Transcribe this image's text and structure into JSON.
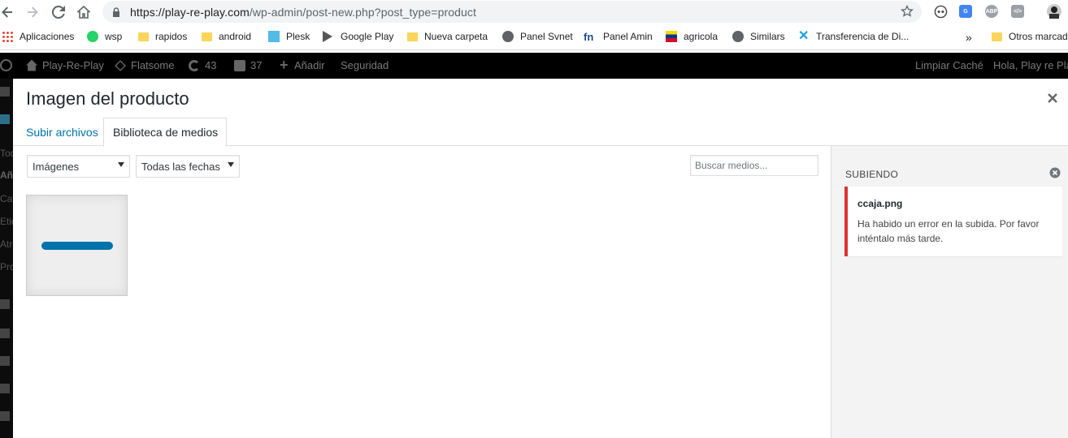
{
  "browser": {
    "url_host": "https://play-re-play.com",
    "url_path": "/wp-admin/post-new.php?post_type=product",
    "bookmarks": [
      {
        "label": "Aplicaciones",
        "icon": "apps-grid-icon"
      },
      {
        "label": "wsp",
        "icon": "whatsapp-icon"
      },
      {
        "label": "rapidos",
        "icon": "folder-icon"
      },
      {
        "label": "android",
        "icon": "folder-icon"
      },
      {
        "label": "Plesk",
        "icon": "plesk-icon"
      },
      {
        "label": "Google Play",
        "icon": "google-play-icon"
      },
      {
        "label": "Nueva carpeta",
        "icon": "folder-icon"
      },
      {
        "label": "Panel Svnet",
        "icon": "globe-icon"
      },
      {
        "label": "Panel Amin",
        "icon": "fn-icon"
      },
      {
        "label": "agricola",
        "icon": "flag-icon"
      },
      {
        "label": "Similars",
        "icon": "globe-icon"
      },
      {
        "label": "Transferencia de Di...",
        "icon": "x-logo-icon"
      }
    ],
    "more_bookmarks": "»",
    "other_bookmarks": "Otros marcad"
  },
  "adminbar": {
    "site_name": "Play-Re-Play",
    "theme": "Flatsome",
    "updates": "43",
    "comments": "37",
    "add_new": "Añadir",
    "security": "Seguridad",
    "clear_cache": "Limpiar Caché",
    "greeting": "Hola, Play re Pla"
  },
  "sidebar": {
    "items": [
      "Tod",
      "Añ",
      "Cat",
      "Etiq",
      "Atr",
      "Pro"
    ]
  },
  "modal": {
    "title": "Imagen del producto",
    "tabs": [
      {
        "label": "Subir archivos",
        "active": false
      },
      {
        "label": "Biblioteca de medios",
        "active": true
      }
    ],
    "filters": {
      "type_selected": "Imágenes",
      "date_selected": "Todas las fechas"
    },
    "search_placeholder": "Buscar medios...",
    "upload_progress_percent": 100
  },
  "uploading_panel": {
    "title": "Subiendo",
    "error": {
      "filename": "ccaja.png",
      "message": "Ha habido un error en la subida. Por favor inténtalo más tarde."
    }
  },
  "colors": {
    "accent": "#0073aa",
    "error": "#dc3232",
    "adminbar_bg": "#000000"
  }
}
